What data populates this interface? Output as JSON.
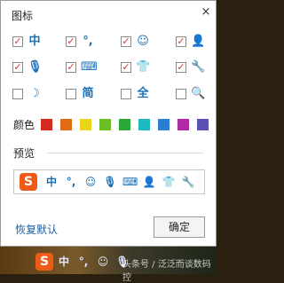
{
  "title": "图标",
  "close_glyph": "×",
  "icons": [
    {
      "name": "chinese-mode-icon",
      "glyph": "中",
      "checked": true
    },
    {
      "name": "punctuation-icon",
      "glyph": "°,",
      "checked": true
    },
    {
      "name": "emoji-icon",
      "glyph": "☺",
      "checked": true
    },
    {
      "name": "user-icon",
      "glyph": "👤",
      "checked": true
    },
    {
      "name": "microphone-icon",
      "glyph": "🎙",
      "checked": true
    },
    {
      "name": "keyboard-icon",
      "glyph": "⌨",
      "checked": true
    },
    {
      "name": "skin-shirt-icon",
      "glyph": "👕",
      "checked": true
    },
    {
      "name": "wrench-icon",
      "glyph": "🔧",
      "checked": true
    },
    {
      "name": "half-width-moon-icon",
      "glyph": "☽",
      "checked": false
    },
    {
      "name": "simplified-icon",
      "glyph": "简",
      "checked": false
    },
    {
      "name": "full-width-icon",
      "glyph": "全",
      "checked": false
    },
    {
      "name": "search-icon",
      "glyph": "🔍",
      "checked": false
    }
  ],
  "color_label": "颜色",
  "colors": [
    "#d52b1e",
    "#e06a16",
    "#e9d51a",
    "#6bbf24",
    "#2aa836",
    "#1fb9c2",
    "#2b7fd1",
    "#b02aa8",
    "#5b4fb4"
  ],
  "preview_label": "预览",
  "preview_logo": "S",
  "preview_glyphs": [
    {
      "name": "chinese-mode-icon",
      "glyph": "中"
    },
    {
      "name": "punctuation-icon",
      "glyph": "°,"
    },
    {
      "name": "emoji-icon",
      "glyph": "☺"
    },
    {
      "name": "microphone-icon",
      "glyph": "🎙"
    },
    {
      "name": "keyboard-icon",
      "glyph": "⌨"
    },
    {
      "name": "user-icon",
      "glyph": "👤"
    },
    {
      "name": "skin-shirt-icon",
      "glyph": "👕"
    },
    {
      "name": "wrench-icon",
      "glyph": "🔧"
    }
  ],
  "restore_default": "恢复默认",
  "ok_button": "确定",
  "taskbar_watermark": "头条号 / 泛泛而谈数码控",
  "taskbar_glyphs": [
    {
      "name": "chinese-mode-icon",
      "glyph": "中"
    },
    {
      "name": "punctuation-icon",
      "glyph": "°,"
    },
    {
      "name": "emoji-icon",
      "glyph": "☺"
    },
    {
      "name": "microphone-icon",
      "glyph": "🎙"
    }
  ]
}
